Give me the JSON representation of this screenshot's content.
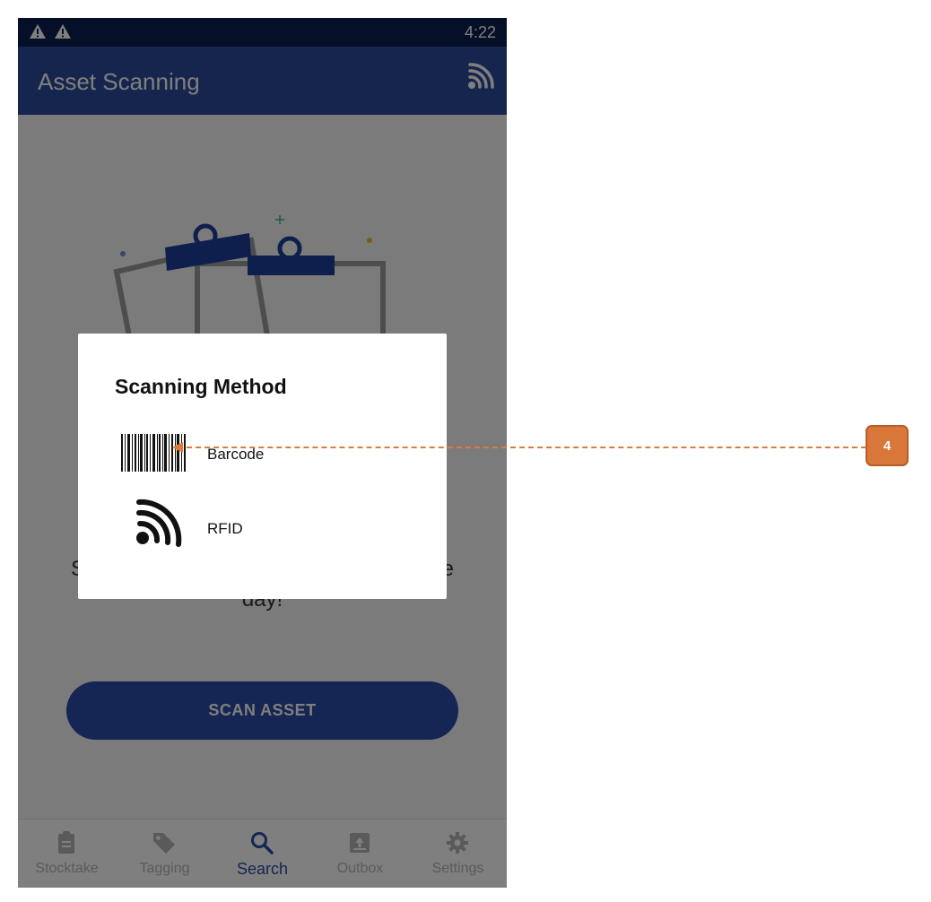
{
  "status_bar": {
    "time": "4:22",
    "icons": [
      "warning-icon",
      "warning-icon"
    ]
  },
  "app_bar": {
    "title": "Asset Scanning",
    "action_icon": "rfid-icon"
  },
  "main": {
    "illustration_icon": "clipboard-illustration",
    "message": "Start scanning assets to finish up for the day!",
    "scan_button_label": "SCAN ASSET"
  },
  "bottom_nav": {
    "items": [
      {
        "label": "Stocktake",
        "icon": "clipboard-icon",
        "active": false
      },
      {
        "label": "Tagging",
        "icon": "tag-icon",
        "active": false
      },
      {
        "label": "Search",
        "icon": "search-icon",
        "active": true
      },
      {
        "label": "Outbox",
        "icon": "outbox-icon",
        "active": false
      },
      {
        "label": "Settings",
        "icon": "gear-icon",
        "active": false
      }
    ]
  },
  "dialog": {
    "title": "Scanning Method",
    "options": [
      {
        "label": "Barcode",
        "icon": "barcode-icon"
      },
      {
        "label": "RFID",
        "icon": "rfid-icon"
      }
    ]
  },
  "annotation": {
    "badge": "4",
    "color": "#d9773a"
  },
  "colors": {
    "primary": "#2a4aa8",
    "status_bar": "#0a1e4f",
    "accent_orange": "#e07a3c"
  }
}
